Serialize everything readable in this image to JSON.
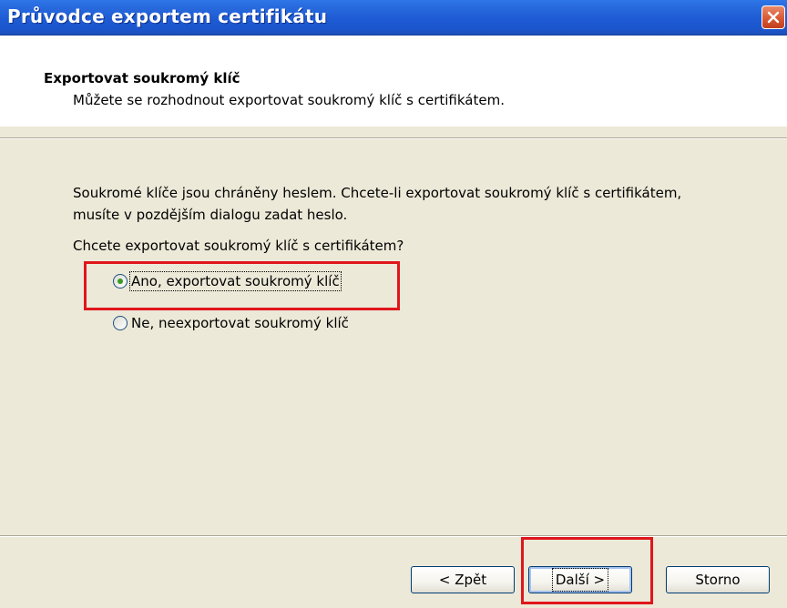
{
  "window": {
    "title": "Průvodce exportem certifikátu",
    "close_icon": "close-icon"
  },
  "header": {
    "title": "Exportovat soukromý klíč",
    "subtitle": "Můžete se rozhodnout exportovat soukromý klíč s certifikátem."
  },
  "body": {
    "description": "Soukromé klíče jsou chráněny heslem. Chcete-li exportovat soukromý klíč s certifikátem, musíte v pozdějším dialogu zadat heslo.",
    "question": "Chcete exportovat soukromý klíč s certifikátem?"
  },
  "options": [
    {
      "label": "Ano, exportovat soukromý klíč",
      "selected": true
    },
    {
      "label": "Ne, neexportovat soukromý klíč",
      "selected": false
    }
  ],
  "buttons": {
    "back": "< Zpět",
    "next": "Další >",
    "cancel": "Storno"
  },
  "colors": {
    "highlight": "#e0161c",
    "titlebar": "#1e5bd4",
    "dialog_bg": "#ece9d8"
  }
}
